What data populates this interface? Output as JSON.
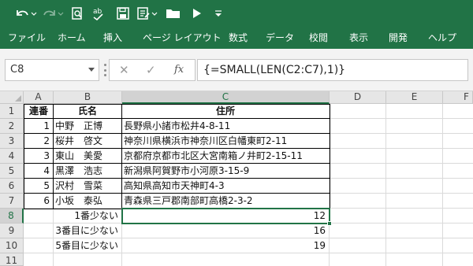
{
  "colors": {
    "accent": "#217346",
    "ribbon_text": "#ffffff",
    "header_bg": "#e6e6e6",
    "header_selected_bg": "#d2d2d2"
  },
  "quick_access": [
    {
      "name": "undo-icon",
      "interactable": true
    },
    {
      "name": "redo-icon",
      "interactable": true
    },
    {
      "name": "print-preview-icon",
      "interactable": true
    },
    {
      "name": "spelling-icon",
      "interactable": true
    },
    {
      "name": "save-icon",
      "interactable": true
    },
    {
      "name": "form-icon",
      "interactable": true
    },
    {
      "name": "open-folder-icon",
      "interactable": true
    },
    {
      "name": "play-macro-icon",
      "interactable": true
    },
    {
      "name": "customize-qat-icon",
      "interactable": true
    }
  ],
  "ribbon": {
    "tabs": [
      {
        "label": "ファイル"
      },
      {
        "label": "ホーム"
      },
      {
        "label": "挿入"
      },
      {
        "label": "ページ レイアウト"
      },
      {
        "label": "数式"
      },
      {
        "label": "データ"
      },
      {
        "label": "校閲"
      },
      {
        "label": "表示"
      },
      {
        "label": "開発"
      },
      {
        "label": "ヘルプ"
      }
    ]
  },
  "formula_bar": {
    "name_box": "C8",
    "cancel_icon": "✕",
    "enter_icon": "✓",
    "fx_icon": "fx",
    "formula": "{=SMALL(LEN(C2:C7),1)}"
  },
  "sheet": {
    "columns": [
      "A",
      "B",
      "C",
      "D",
      "E",
      "F"
    ],
    "selected_column": "C",
    "rows": [
      "1",
      "2",
      "3",
      "4",
      "5",
      "6",
      "7",
      "8",
      "9",
      "10",
      "11"
    ],
    "selected_row": "8",
    "headers": {
      "a": "連番",
      "b": "氏名",
      "c": "住所"
    },
    "records": [
      {
        "num": "1",
        "name": "中野　正博",
        "address": "長野県小諸市松井4-8-11"
      },
      {
        "num": "2",
        "name": "桜井　啓文",
        "address": "神奈川県横浜市神奈川区白幡東町2-11"
      },
      {
        "num": "3",
        "name": "東山　美愛",
        "address": "京都府京都市北区大宮南箱ノ井町2-15-11"
      },
      {
        "num": "4",
        "name": "黒澤　浩志",
        "address": "新潟県阿賀野市小河原3-15-9"
      },
      {
        "num": "5",
        "name": "沢村　雪菜",
        "address": "高知県高知市天神町4-3"
      },
      {
        "num": "6",
        "name": "小坂　泰弘",
        "address": "青森県三戸郡南部町高橋2-3-2"
      }
    ],
    "results": [
      {
        "label": "1番少ない",
        "value": "12"
      },
      {
        "label": "3番目に少ない",
        "value": "16"
      },
      {
        "label": "5番目に少ない",
        "value": "19"
      }
    ]
  }
}
